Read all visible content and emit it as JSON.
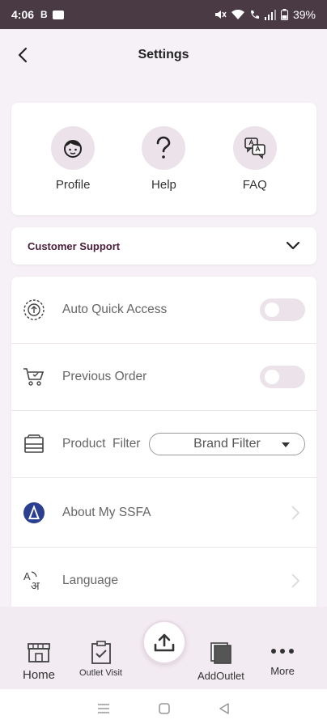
{
  "status_bar": {
    "time": "4:06",
    "left_icons": [
      "B-icon",
      "youtube-icon"
    ],
    "right_icons": [
      "mute-icon",
      "wifi-icon",
      "call-icon",
      "signal-icon",
      "battery-icon"
    ],
    "battery": "39%"
  },
  "header": {
    "title": "Settings"
  },
  "quick_actions": [
    {
      "label": "Profile",
      "icon": "profile-face-icon"
    },
    {
      "label": "Help",
      "icon": "question-icon"
    },
    {
      "label": "FAQ",
      "icon": "faq-chat-icon"
    }
  ],
  "support": {
    "label": "Customer Support"
  },
  "settings": {
    "auto_quick_access": {
      "label": "Auto Quick Access",
      "enabled": false
    },
    "previous_order": {
      "label": "Previous Order",
      "enabled": false
    },
    "product_filter": {
      "label": "Product  Filter",
      "selected": "Brand Filter"
    },
    "about": {
      "label": "About My SSFA"
    },
    "language": {
      "label": "Language"
    }
  },
  "bottom_nav": {
    "home": "Home",
    "outlet_visit": "Outlet Visit",
    "add_outlet": "AddOutlet",
    "more": "More"
  },
  "colors": {
    "accent": "#4a1f3a",
    "toggle_off": "#ebe2ea",
    "status_bar": "#4a3a44"
  }
}
